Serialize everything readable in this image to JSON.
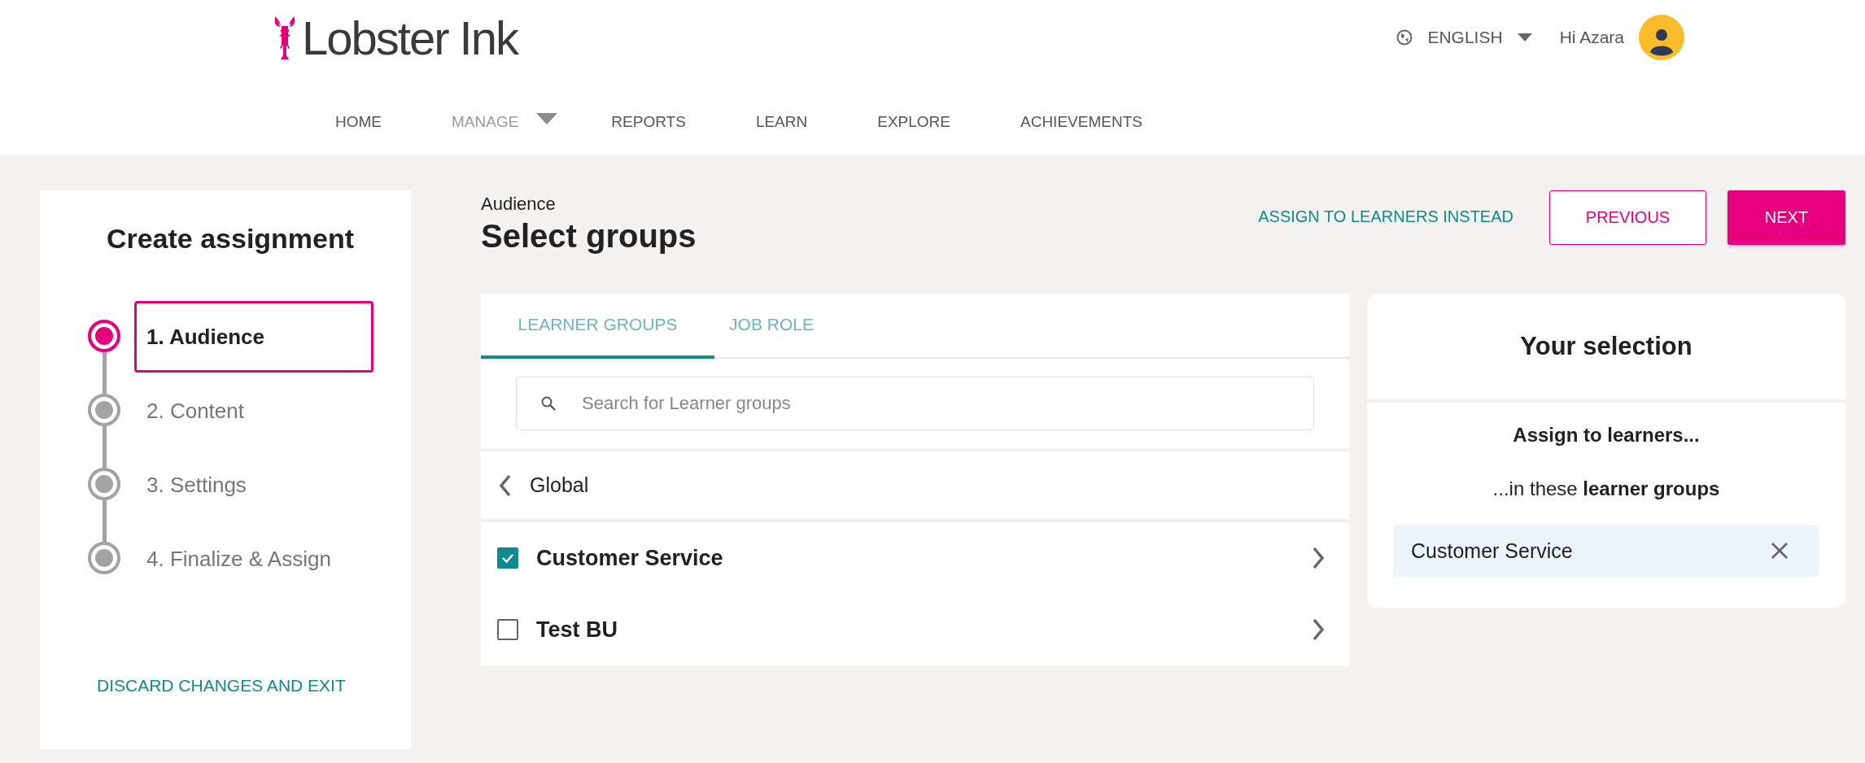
{
  "header": {
    "logo": "Lobster Ink",
    "language": "ENGLISH",
    "greeting": "Hi Azara"
  },
  "nav": [
    {
      "label": "HOME",
      "selected": false,
      "dropdown": false
    },
    {
      "label": "MANAGE",
      "selected": true,
      "dropdown": true
    },
    {
      "label": "REPORTS",
      "selected": false,
      "dropdown": false
    },
    {
      "label": "LEARN",
      "selected": false,
      "dropdown": false
    },
    {
      "label": "EXPLORE",
      "selected": false,
      "dropdown": false
    },
    {
      "label": "ACHIEVEMENTS",
      "selected": false,
      "dropdown": false
    }
  ],
  "sidebar": {
    "title": "Create assignment",
    "steps": [
      {
        "label": "1. Audience",
        "selected": true
      },
      {
        "label": "2. Content",
        "selected": false
      },
      {
        "label": "3. Settings",
        "selected": false
      },
      {
        "label": "4. Finalize & Assign",
        "selected": false
      }
    ],
    "discard": "DISCARD CHANGES AND EXIT"
  },
  "page": {
    "eyebrow": "Audience",
    "title": "Select groups",
    "alt_link": "ASSIGN TO LEARNERS INSTEAD",
    "buttons": [
      {
        "label": "PREVIOUS",
        "kind": "outline"
      },
      {
        "label": "NEXT",
        "kind": "primary"
      }
    ]
  },
  "tabs": [
    {
      "label": "LEARNER GROUPS",
      "selected": true
    },
    {
      "label": "JOB ROLE",
      "selected": false
    }
  ],
  "search": {
    "placeholder": "Search for Learner groups"
  },
  "breadcrumb": "Global",
  "groups": [
    {
      "name": "Customer Service",
      "checked": true
    },
    {
      "name": "Test BU",
      "checked": false
    }
  ],
  "selection": {
    "title": "Your selection",
    "lead": "Assign to learners...",
    "subtitle": "...in these **learner groups**",
    "chips": [
      "Customer Service"
    ]
  }
}
